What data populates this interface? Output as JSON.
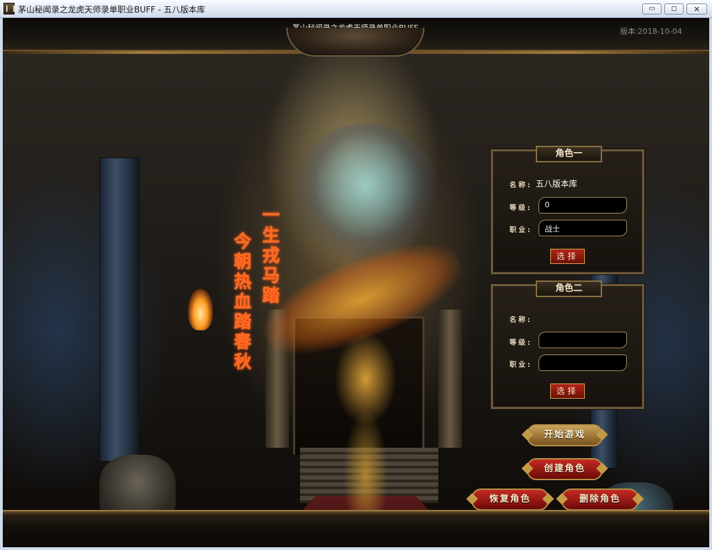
{
  "window": {
    "title": "茅山秘闻录之龙虎天师录单职业BUFF - 五八版本库",
    "icon": "game-app-icon",
    "controls": {
      "minimize": "▭",
      "maximize": "◻",
      "close": "✕"
    }
  },
  "header": {
    "title": "茅山秘闻录之龙虎天师录单职业BUFF",
    "version": "版本:2018-10-04"
  },
  "slogan": {
    "col1": "今朝热血踏春秋",
    "col2": "一生戎马踏"
  },
  "character_one": {
    "label": "角色一",
    "name_label": "名称:",
    "name_value": "五八版本库",
    "level_label": "等级:",
    "level_value": "0",
    "job_label": "职业:",
    "job_value": "战士",
    "select_label": "选择"
  },
  "character_two": {
    "label": "角色二",
    "name_label": "名称:",
    "name_value": "",
    "level_label": "等级:",
    "level_value": "",
    "job_label": "职业:",
    "job_value": "",
    "select_label": "选择"
  },
  "actions": {
    "start_game": "开始游戏",
    "create_role": "创建角色",
    "restore_role": "恢复角色",
    "delete_role": "删除角色"
  },
  "colors": {
    "panel_border": "#6d5a3a",
    "slogan": "#ff6a22",
    "button_red": "#c62a22",
    "button_gold": "#c9a25a"
  }
}
